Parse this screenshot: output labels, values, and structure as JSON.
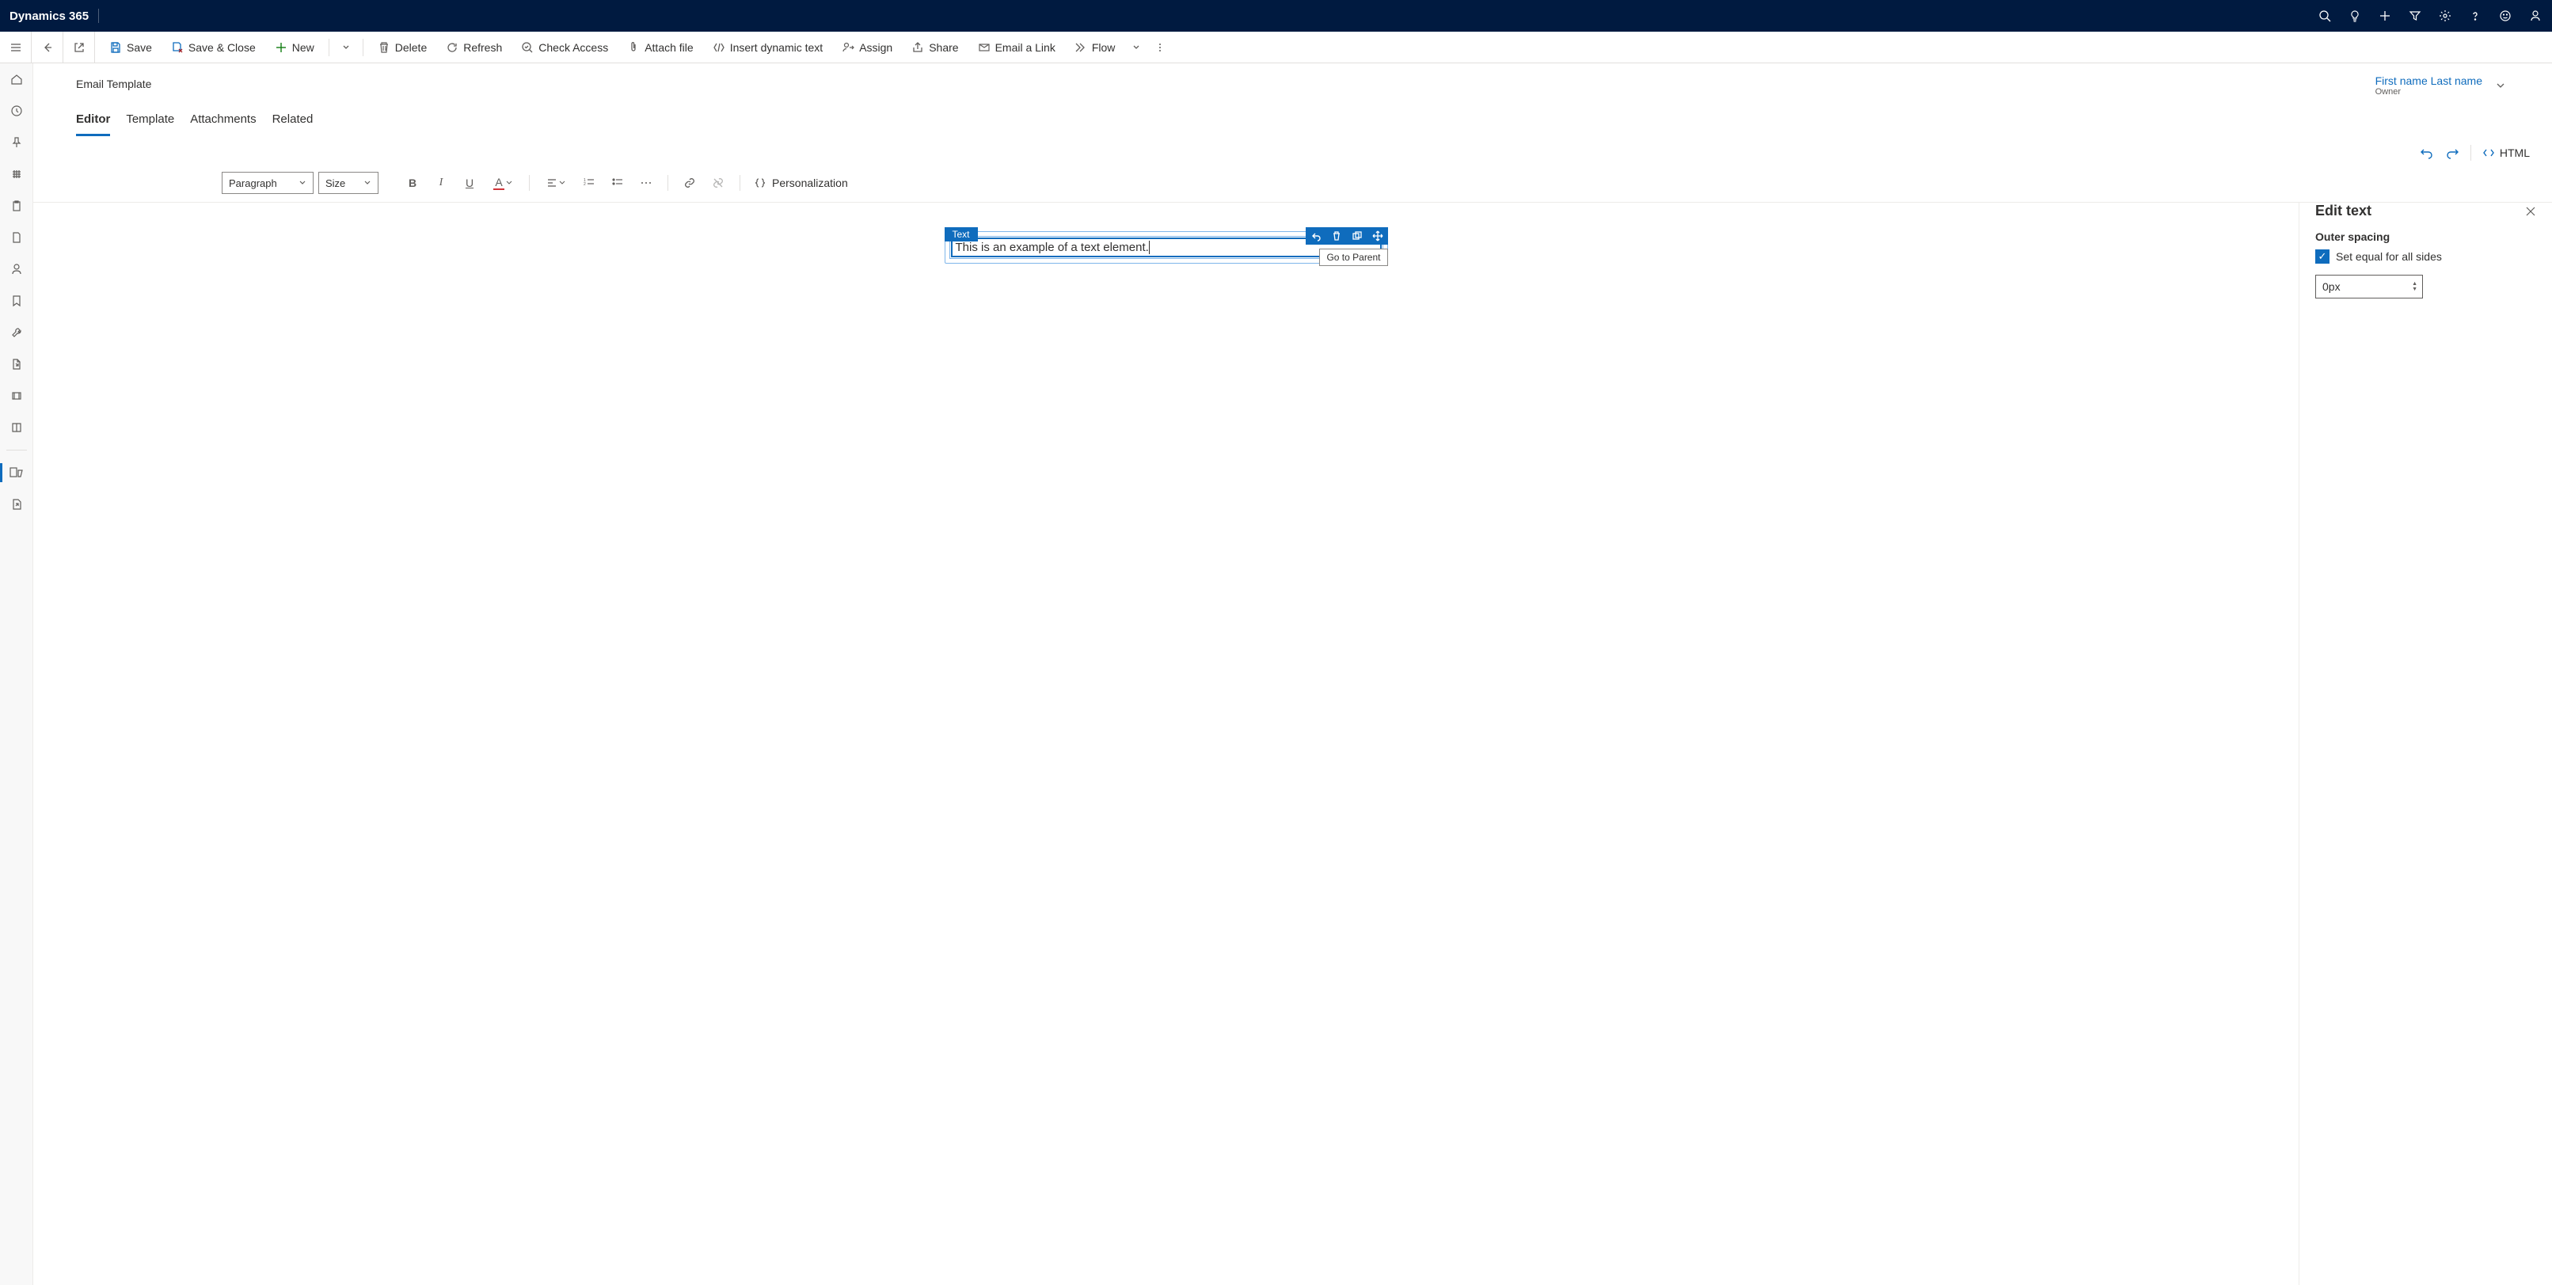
{
  "app": {
    "brand": "Dynamics 365"
  },
  "commands": {
    "save": "Save",
    "save_close": "Save & Close",
    "new": "New",
    "delete": "Delete",
    "refresh": "Refresh",
    "check_access": "Check Access",
    "attach_file": "Attach file",
    "insert_dynamic": "Insert dynamic text",
    "assign": "Assign",
    "share": "Share",
    "email_link": "Email a Link",
    "flow": "Flow"
  },
  "record": {
    "entity_label": "Email Template",
    "owner_name": "First name Last name",
    "owner_label": "Owner"
  },
  "tabs": {
    "editor": "Editor",
    "template": "Template",
    "attachments": "Attachments",
    "related": "Related"
  },
  "editor_toolbar": {
    "html": "HTML"
  },
  "rte": {
    "paragraph": "Paragraph",
    "size": "Size",
    "personalization": "Personalization"
  },
  "selection": {
    "label": "Text",
    "tooltip": "Go to Parent",
    "text_content": "This is an example of a text element."
  },
  "right_panel": {
    "title": "Edit text",
    "section": "Outer spacing",
    "equal_sides": "Set equal for all sides",
    "spacing_value": "0px"
  }
}
